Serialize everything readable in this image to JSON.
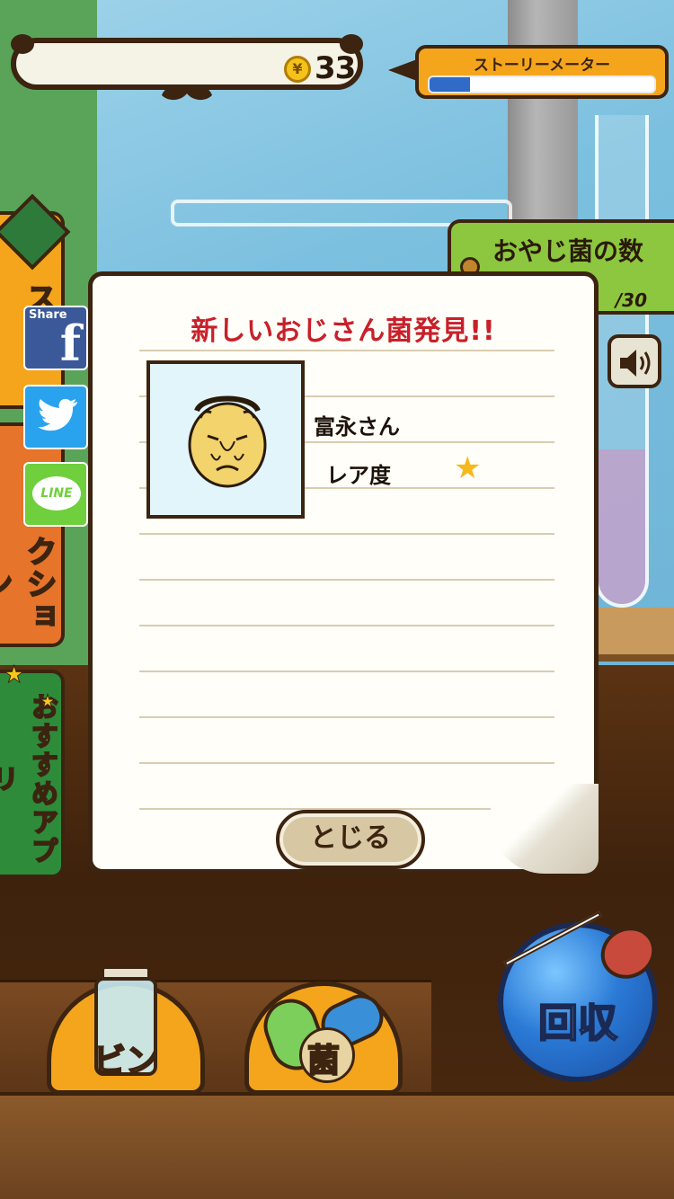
{
  "top_bar": {
    "coin_symbol": "¥",
    "coin_count": "33",
    "story_meter_label": "ストーリーメーター",
    "story_progress": 0.18
  },
  "side_tabs": {
    "story": "スト",
    "collection": "クション",
    "recommend": "おすすめアプリ"
  },
  "social": {
    "facebook_small": "Share",
    "facebook_big": "f",
    "line_label": "LINE"
  },
  "right_panel": {
    "count_title": "おやじ菌の数",
    "count_value": "/30"
  },
  "modal": {
    "title": "新しいおじさん菌発見!!",
    "name": "富永さん",
    "rarity_label": "レア度",
    "rarity_star": "★",
    "close_label": "とじる"
  },
  "bottom": {
    "bin_label": "ビン",
    "kin_label": "菌",
    "collect_label": "回収"
  },
  "colors": {
    "accent_orange": "#f4a51c",
    "title_red": "#c8202a",
    "outline_brown": "#3c2410",
    "meter_blue": "#2f6bc7"
  }
}
